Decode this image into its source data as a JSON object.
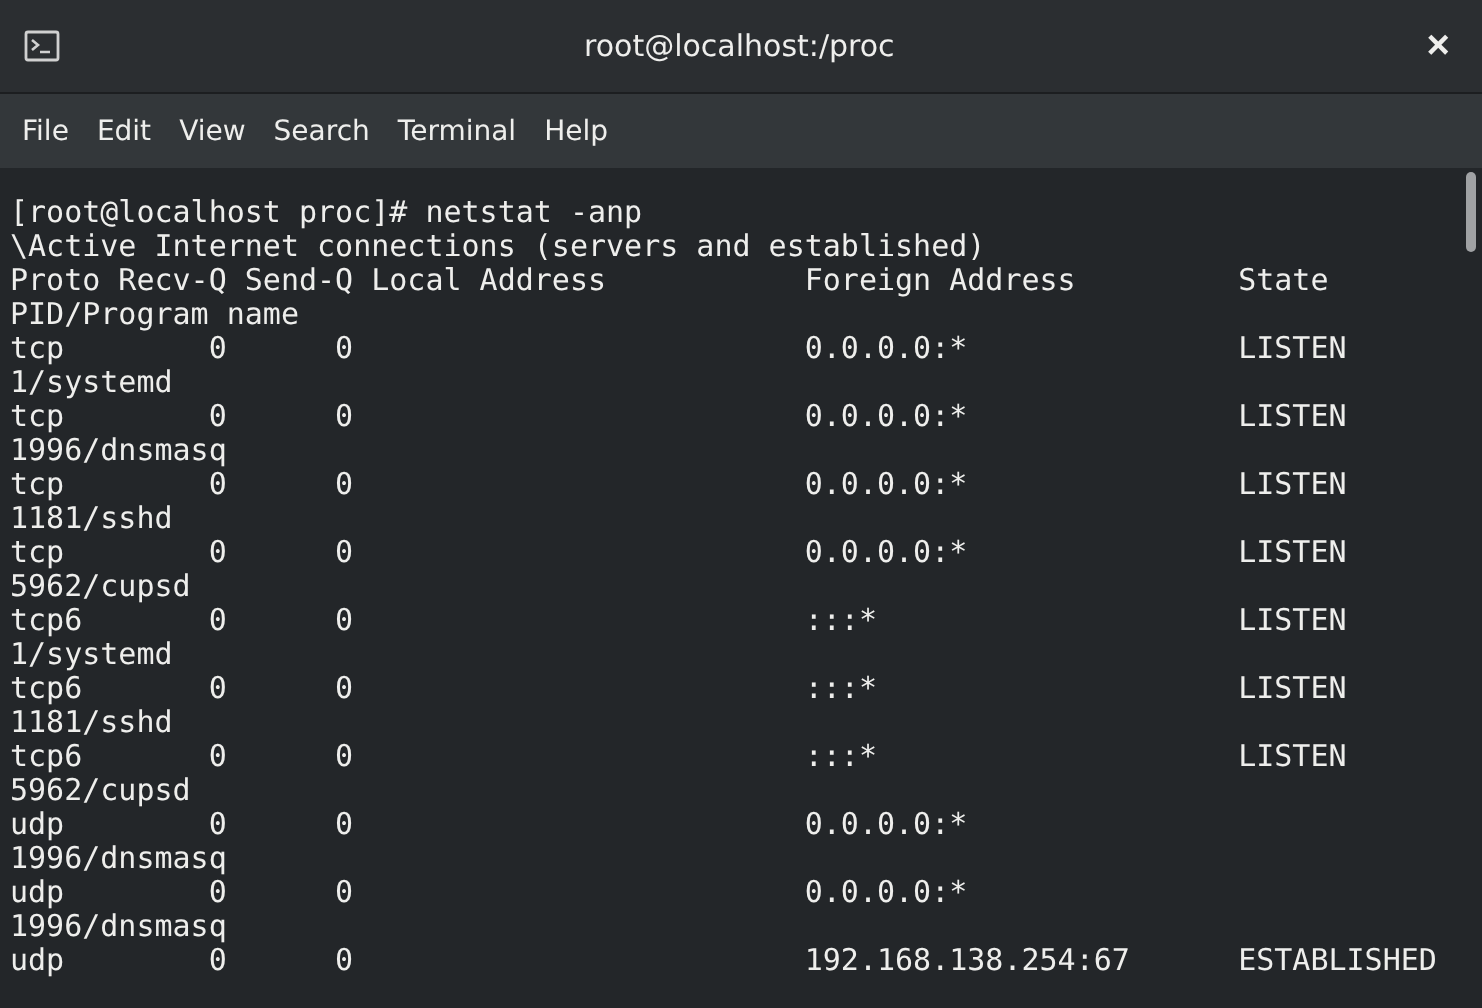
{
  "window": {
    "title": "root@localhost:/proc",
    "close": "×"
  },
  "menu": [
    "File",
    "Edit",
    "View",
    "Search",
    "Terminal",
    "Help"
  ],
  "terminal": {
    "lines": [
      "[root@localhost proc]# netstat -anp",
      "\\Active Internet connections (servers and established)",
      "Proto Recv-Q Send-Q Local Address           Foreign Address         State",
      "PID/Program name",
      "tcp        0      0                         0.0.0.0:*               LISTEN",
      "1/systemd",
      "tcp        0      0                         0.0.0.0:*               LISTEN",
      "1996/dnsmasq",
      "tcp        0      0                         0.0.0.0:*               LISTEN",
      "1181/sshd",
      "tcp        0      0                         0.0.0.0:*               LISTEN",
      "5962/cupsd",
      "tcp6       0      0                         :::*                    LISTEN",
      "1/systemd",
      "tcp6       0      0                         :::*                    LISTEN",
      "1181/sshd",
      "tcp6       0      0                         :::*                    LISTEN",
      "5962/cupsd",
      "udp        0      0                         0.0.0.0:*",
      "1996/dnsmasq",
      "udp        0      0                         0.0.0.0:*",
      "1996/dnsmasq",
      "udp        0      0                         192.168.138.254:67      ESTABLISHED"
    ]
  }
}
